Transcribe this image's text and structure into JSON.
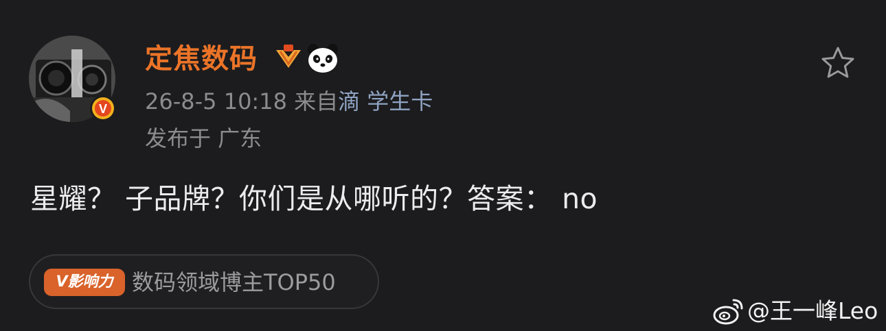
{
  "post": {
    "user_name": "定焦数码",
    "timestamp": "26-8-5 10:18",
    "source_prefix": "来自",
    "source_app": "滴 学生卡",
    "location": "发布于 广东",
    "body": "星耀？ 子品牌？你们是从哪听的？答案： no"
  },
  "badges": {
    "verified": "V",
    "influence_tag": "V影响力",
    "influence_text": "数码领域博主TOP50"
  },
  "icons": {
    "avatar": "camera-photo-avatar",
    "verified": "verified-v-icon",
    "fan_badge": "fan-level-icon",
    "panda": "panda-icon",
    "favorite": "star-outline-icon",
    "watermark": "weibo-icon"
  },
  "watermark": {
    "text": "@王一峰Leo"
  },
  "colors": {
    "background": "#1c1c1e",
    "user_name": "#eb7428",
    "meta": "#8c8c8e",
    "link": "#8fa3c2",
    "influence_tag": "#d9632b"
  }
}
